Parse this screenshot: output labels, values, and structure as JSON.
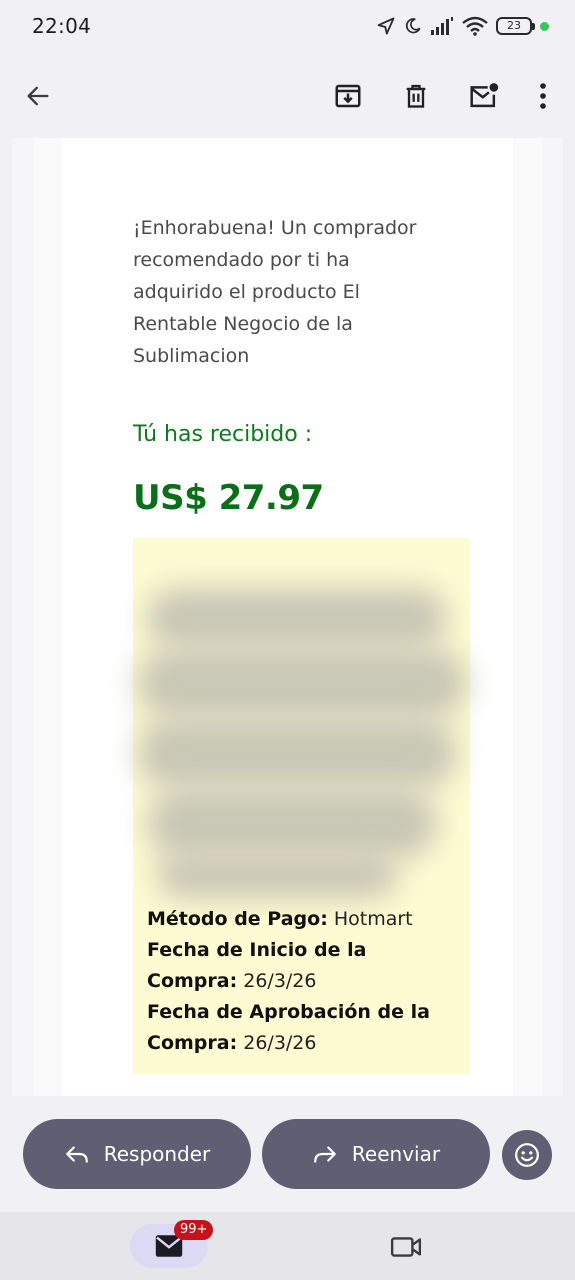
{
  "status": {
    "time": "22:04",
    "battery": "23",
    "icons": [
      "location-icon",
      "moon-icon",
      "signal-icon",
      "wifi-icon",
      "battery-icon",
      "privacy-dot"
    ]
  },
  "toolbar": {
    "back_icon": "arrow-back-icon",
    "actions": [
      "archive-icon",
      "delete-icon",
      "mark-unread-icon",
      "more-vert-icon"
    ]
  },
  "email": {
    "intro": "¡Enhorabuena! Un comprador recomendado por ti ha adquirido el producto El Rentable Negocio de la Sublimacion",
    "received_label": "Tú has recibido :",
    "amount": "US$ 27.97",
    "details": {
      "payment_method_label": "Método de Pago:",
      "payment_method_value": "Hotmart",
      "start_date_label": "Fecha de Inicio de la Compra:",
      "start_date_value": "26/3/26",
      "approval_date_label": "Fecha de Aprobación de la Compra:",
      "approval_date_value": "26/3/26"
    },
    "box_color": "#fdfbd1",
    "accent_green": "#0b6e18"
  },
  "actions": {
    "reply_label": "Responder",
    "forward_label": "Reenviar",
    "emoji_icon": "emoji-icon"
  },
  "nav": {
    "mail_badge": "99+",
    "mail_icon": "mail-icon",
    "meet_icon": "video-icon"
  }
}
